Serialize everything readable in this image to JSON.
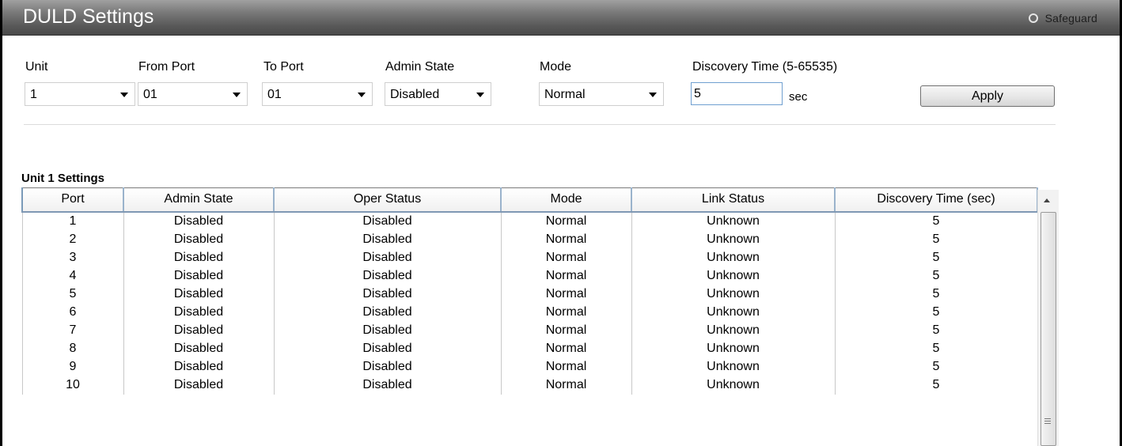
{
  "header": {
    "title": "DULD Settings",
    "safeguard_label": "Safeguard"
  },
  "form": {
    "unit": {
      "label": "Unit",
      "value": "1"
    },
    "from_port": {
      "label": "From Port",
      "value": "01"
    },
    "to_port": {
      "label": "To Port",
      "value": "01"
    },
    "admin_state": {
      "label": "Admin State",
      "value": "Disabled"
    },
    "mode": {
      "label": "Mode",
      "value": "Normal"
    },
    "discovery_time": {
      "label": "Discovery Time (5-65535)",
      "value": "5",
      "unit": "sec"
    },
    "apply_label": "Apply"
  },
  "table": {
    "heading": "Unit 1 Settings",
    "columns": [
      "Port",
      "Admin State",
      "Oper Status",
      "Mode",
      "Link Status",
      "Discovery Time (sec)"
    ],
    "rows": [
      [
        "1",
        "Disabled",
        "Disabled",
        "Normal",
        "Unknown",
        "5"
      ],
      [
        "2",
        "Disabled",
        "Disabled",
        "Normal",
        "Unknown",
        "5"
      ],
      [
        "3",
        "Disabled",
        "Disabled",
        "Normal",
        "Unknown",
        "5"
      ],
      [
        "4",
        "Disabled",
        "Disabled",
        "Normal",
        "Unknown",
        "5"
      ],
      [
        "5",
        "Disabled",
        "Disabled",
        "Normal",
        "Unknown",
        "5"
      ],
      [
        "6",
        "Disabled",
        "Disabled",
        "Normal",
        "Unknown",
        "5"
      ],
      [
        "7",
        "Disabled",
        "Disabled",
        "Normal",
        "Unknown",
        "5"
      ],
      [
        "8",
        "Disabled",
        "Disabled",
        "Normal",
        "Unknown",
        "5"
      ],
      [
        "9",
        "Disabled",
        "Disabled",
        "Normal",
        "Unknown",
        "5"
      ],
      [
        "10",
        "Disabled",
        "Disabled",
        "Normal",
        "Unknown",
        "5"
      ]
    ]
  },
  "colors": {
    "titlebar": "#6a6a6a",
    "input_border": "#6f9fd0",
    "header_border": "#7a9ab8"
  }
}
